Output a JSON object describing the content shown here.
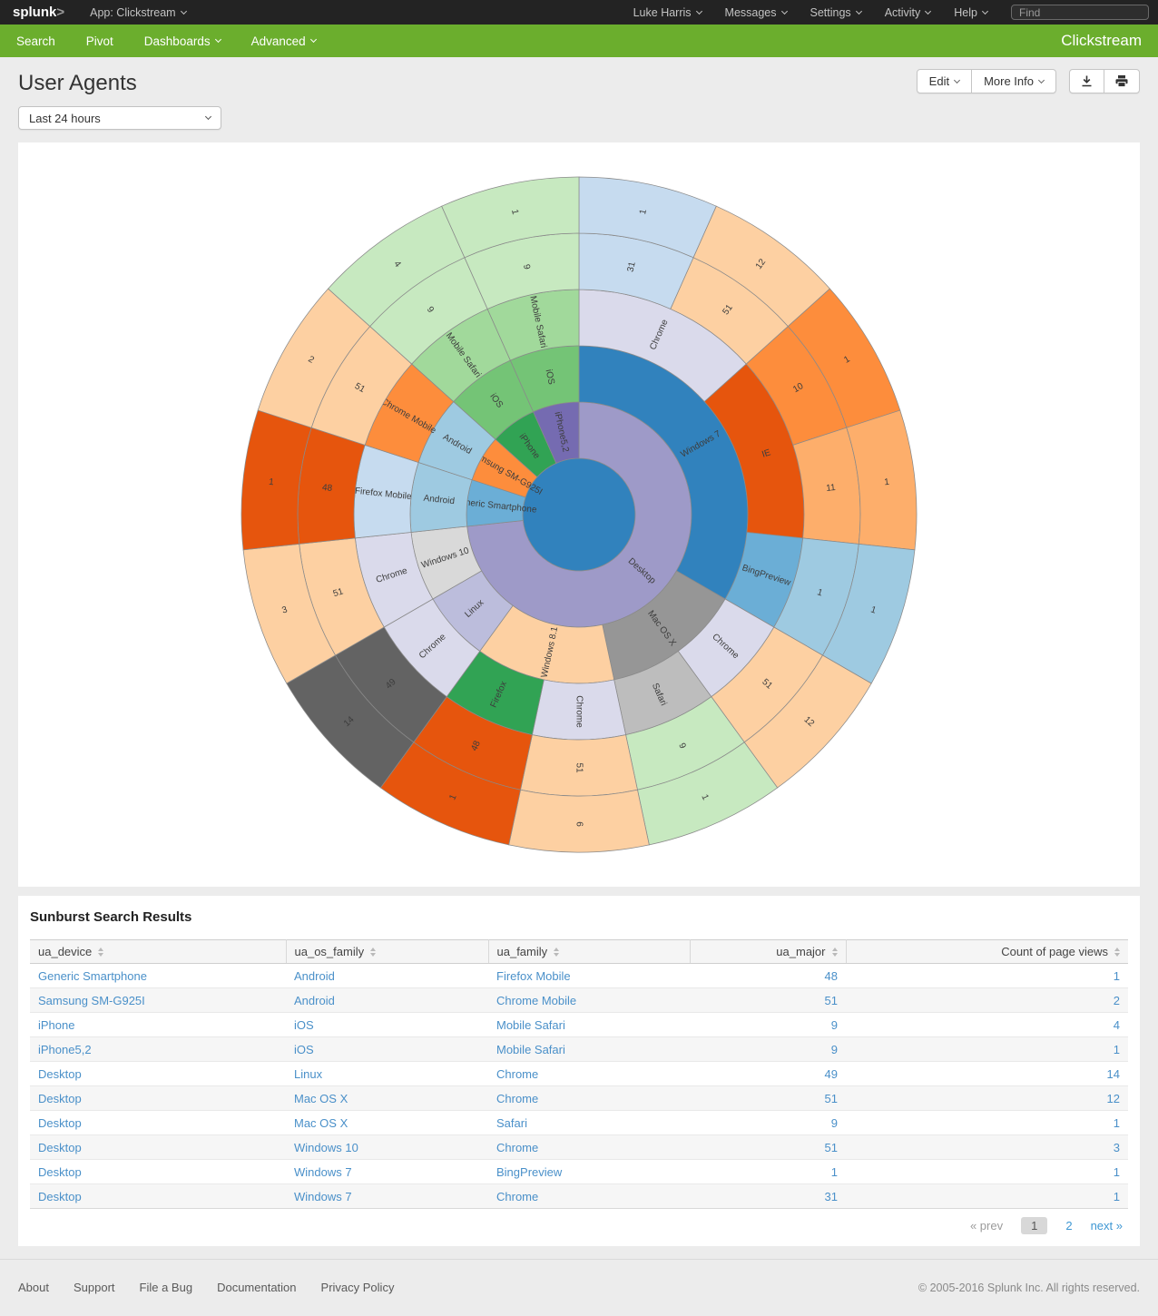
{
  "topbar": {
    "logo": "splunk",
    "logo_mark": ">",
    "app_menu": "App: Clickstream",
    "menus": [
      "Luke Harris",
      "Messages",
      "Settings",
      "Activity",
      "Help"
    ],
    "find_placeholder": "Find"
  },
  "appbar": {
    "items": [
      "Search",
      "Pivot",
      "Dashboards",
      "Advanced"
    ],
    "app_title": "Clickstream"
  },
  "page": {
    "title": "User Agents",
    "time_picker_value": "Last 24 hours",
    "edit_label": "Edit",
    "more_info_label": "More Info"
  },
  "table": {
    "heading": "Sunburst Search Results",
    "columns": [
      "ua_device",
      "ua_os_family",
      "ua_family",
      "ua_major",
      "Count of page views"
    ],
    "rows": [
      [
        "Generic Smartphone",
        "Android",
        "Firefox Mobile",
        "48",
        "1"
      ],
      [
        "Samsung SM-G925I",
        "Android",
        "Chrome Mobile",
        "51",
        "2"
      ],
      [
        "iPhone",
        "iOS",
        "Mobile Safari",
        "9",
        "4"
      ],
      [
        "iPhone5,2",
        "iOS",
        "Mobile Safari",
        "9",
        "1"
      ],
      [
        "Desktop",
        "Linux",
        "Chrome",
        "49",
        "14"
      ],
      [
        "Desktop",
        "Mac OS X",
        "Chrome",
        "51",
        "12"
      ],
      [
        "Desktop",
        "Mac OS X",
        "Safari",
        "9",
        "1"
      ],
      [
        "Desktop",
        "Windows 10",
        "Chrome",
        "51",
        "3"
      ],
      [
        "Desktop",
        "Windows 7",
        "BingPreview",
        "1",
        "1"
      ],
      [
        "Desktop",
        "Windows 7",
        "Chrome",
        "31",
        "1"
      ]
    ],
    "pagination": {
      "prev": "« prev",
      "current": "1",
      "page2": "2",
      "next": "next »"
    }
  },
  "footer": {
    "links": [
      "About",
      "Support",
      "File a Bug",
      "Documentation",
      "Privacy Policy"
    ],
    "copyright": "© 2005-2016 Splunk Inc. All rights reserved."
  },
  "chart_data": {
    "type": "sunburst",
    "levels": [
      "ua_device",
      "ua_os_family",
      "ua_family",
      "ua_major",
      "count_of_page_views"
    ],
    "center_color": "#3182bd",
    "stroke_color": "#8a8a8a",
    "rows": [
      {
        "path": [
          "Desktop",
          "Windows 7",
          "Chrome",
          "31",
          "1"
        ],
        "colors": [
          "#9e9ac8",
          "#3182bd",
          "#dadaeb",
          "#c6dbef",
          "#c6dbef"
        ]
      },
      {
        "path": [
          "Desktop",
          "Windows 7",
          "Chrome",
          "51",
          "12"
        ],
        "colors": [
          "#9e9ac8",
          "#3182bd",
          "#dadaeb",
          "#fdd0a2",
          "#fdd0a2"
        ]
      },
      {
        "path": [
          "Desktop",
          "Windows 7",
          "IE",
          "10",
          "1"
        ],
        "colors": [
          "#9e9ac8",
          "#3182bd",
          "#e6550d",
          "#fd8d3c",
          "#fd8d3c"
        ]
      },
      {
        "path": [
          "Desktop",
          "Windows 7",
          "IE",
          "11",
          "1"
        ],
        "colors": [
          "#9e9ac8",
          "#3182bd",
          "#e6550d",
          "#fdae6b",
          "#fdae6b"
        ]
      },
      {
        "path": [
          "Desktop",
          "Windows 7",
          "BingPreview",
          "1",
          "1"
        ],
        "colors": [
          "#9e9ac8",
          "#3182bd",
          "#6baed6",
          "#9ecae1",
          "#9ecae1"
        ]
      },
      {
        "path": [
          "Desktop",
          "Mac OS X",
          "Chrome",
          "51",
          "12"
        ],
        "colors": [
          "#9e9ac8",
          "#969696",
          "#dadaeb",
          "#fdd0a2",
          "#fdd0a2"
        ]
      },
      {
        "path": [
          "Desktop",
          "Mac OS X",
          "Safari",
          "9",
          "1"
        ],
        "colors": [
          "#9e9ac8",
          "#969696",
          "#bdbdbd",
          "#c7e9c0",
          "#c7e9c0"
        ]
      },
      {
        "path": [
          "Desktop",
          "Windows 8.1",
          "Chrome",
          "51",
          "6"
        ],
        "colors": [
          "#9e9ac8",
          "#fdd0a2",
          "#dadaeb",
          "#fdd0a2",
          "#fdd0a2"
        ]
      },
      {
        "path": [
          "Desktop",
          "Windows 8.1",
          "Firefox",
          "48",
          "1"
        ],
        "colors": [
          "#9e9ac8",
          "#fdd0a2",
          "#31a354",
          "#e6550d",
          "#e6550d"
        ]
      },
      {
        "path": [
          "Desktop",
          "Linux",
          "Chrome",
          "49",
          "14"
        ],
        "colors": [
          "#9e9ac8",
          "#bcbddc",
          "#dadaeb",
          "#636363",
          "#636363"
        ]
      },
      {
        "path": [
          "Desktop",
          "Windows 10",
          "Chrome",
          "51",
          "3"
        ],
        "colors": [
          "#9e9ac8",
          "#d9d9d9",
          "#dadaeb",
          "#fdd0a2",
          "#fdd0a2"
        ]
      },
      {
        "path": [
          "Generic Smartphone",
          "Android",
          "Firefox Mobile",
          "48",
          "1"
        ],
        "colors": [
          "#6baed6",
          "#9ecae1",
          "#c6dbef",
          "#e6550d",
          "#e6550d"
        ]
      },
      {
        "path": [
          "Samsung SM-G925I",
          "Android",
          "Chrome Mobile",
          "51",
          "2"
        ],
        "colors": [
          "#fd8d3c",
          "#9ecae1",
          "#fd8d3c",
          "#fdd0a2",
          "#fdd0a2"
        ]
      },
      {
        "path": [
          "iPhone",
          "iOS",
          "Mobile Safari",
          "9",
          "4"
        ],
        "colors": [
          "#31a354",
          "#74c476",
          "#a1d99b",
          "#c7e9c0",
          "#c7e9c0"
        ]
      },
      {
        "path": [
          "iPhone5,2",
          "iOS",
          "Mobile Safari",
          "9",
          "1"
        ],
        "colors": [
          "#756bb1",
          "#74c476",
          "#a1d99b",
          "#c7e9c0",
          "#c7e9c0"
        ]
      }
    ]
  }
}
